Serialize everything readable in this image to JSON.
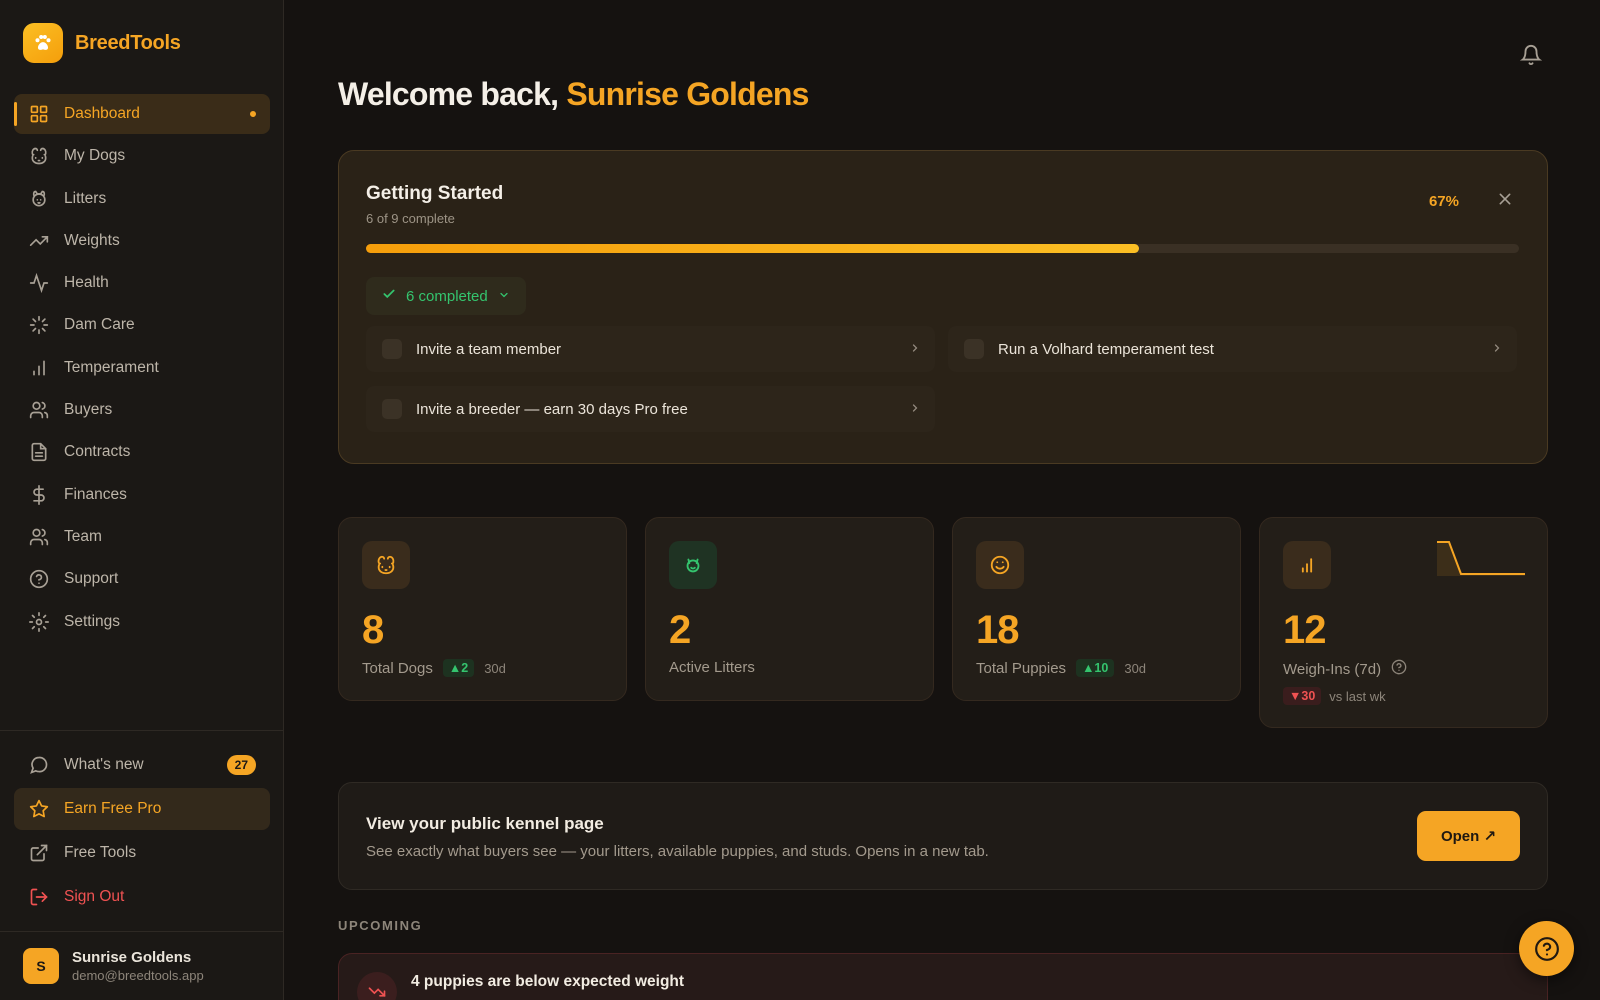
{
  "brand": {
    "name": "BreedTools"
  },
  "sidebar": {
    "items": [
      {
        "label": "Dashboard",
        "icon": "grid-icon"
      },
      {
        "label": "My Dogs",
        "icon": "dog-icon"
      },
      {
        "label": "Litters",
        "icon": "puppy-icon"
      },
      {
        "label": "Weights",
        "icon": "trending-up-icon"
      },
      {
        "label": "Health",
        "icon": "activity-icon"
      },
      {
        "label": "Dam Care",
        "icon": "sparkle-icon"
      },
      {
        "label": "Temperament",
        "icon": "bar-chart-icon"
      },
      {
        "label": "Buyers",
        "icon": "users-icon"
      },
      {
        "label": "Contracts",
        "icon": "document-icon"
      },
      {
        "label": "Finances",
        "icon": "dollar-icon"
      },
      {
        "label": "Team",
        "icon": "team-icon"
      },
      {
        "label": "Support",
        "icon": "help-circle-icon"
      },
      {
        "label": "Settings",
        "icon": "settings-icon"
      }
    ],
    "bottom": {
      "whats_new": "What's new",
      "whats_new_count": "27",
      "earn_pro": "Earn Free Pro",
      "free_tools": "Free Tools",
      "sign_out": "Sign Out"
    },
    "user": {
      "initial": "S",
      "name": "Sunrise Goldens",
      "email": "demo@breedtools.app"
    }
  },
  "header": {
    "welcome_prefix": "Welcome back, ",
    "kennel_name": "Sunrise Goldens"
  },
  "getting_started": {
    "title": "Getting Started",
    "subtitle": "6 of 9 complete",
    "percent_label": "67%",
    "progress": 0.67,
    "completed_label": "6 completed",
    "tasks": [
      "Invite a team member",
      "Run a Volhard temperament test",
      "Invite a breeder — earn 30 days Pro free"
    ]
  },
  "stats": [
    {
      "value": "8",
      "label": "Total Dogs",
      "delta": "▲2",
      "period": "30d",
      "icon": "dog-face-icon"
    },
    {
      "value": "2",
      "label": "Active Litters",
      "icon": "puppy-face-icon"
    },
    {
      "value": "18",
      "label": "Total Puppies",
      "delta": "▲10",
      "period": "30d",
      "icon": "smile-icon"
    },
    {
      "value": "12",
      "label": "Weigh-Ins (7d)",
      "delta": "▼30",
      "period": "vs last wk",
      "icon": "bar-chart-icon"
    }
  ],
  "kennel": {
    "title": "View your public kennel page",
    "description": "See exactly what buyers see — your litters, available puppies, and studs. Opens in a new tab.",
    "button": "Open ↗"
  },
  "upcoming": {
    "heading": "UPCOMING",
    "alert_title": "4 puppies are below expected weight"
  },
  "colors": {
    "accent": "#f5a524",
    "success": "#34c46e",
    "danger": "#f05252"
  }
}
